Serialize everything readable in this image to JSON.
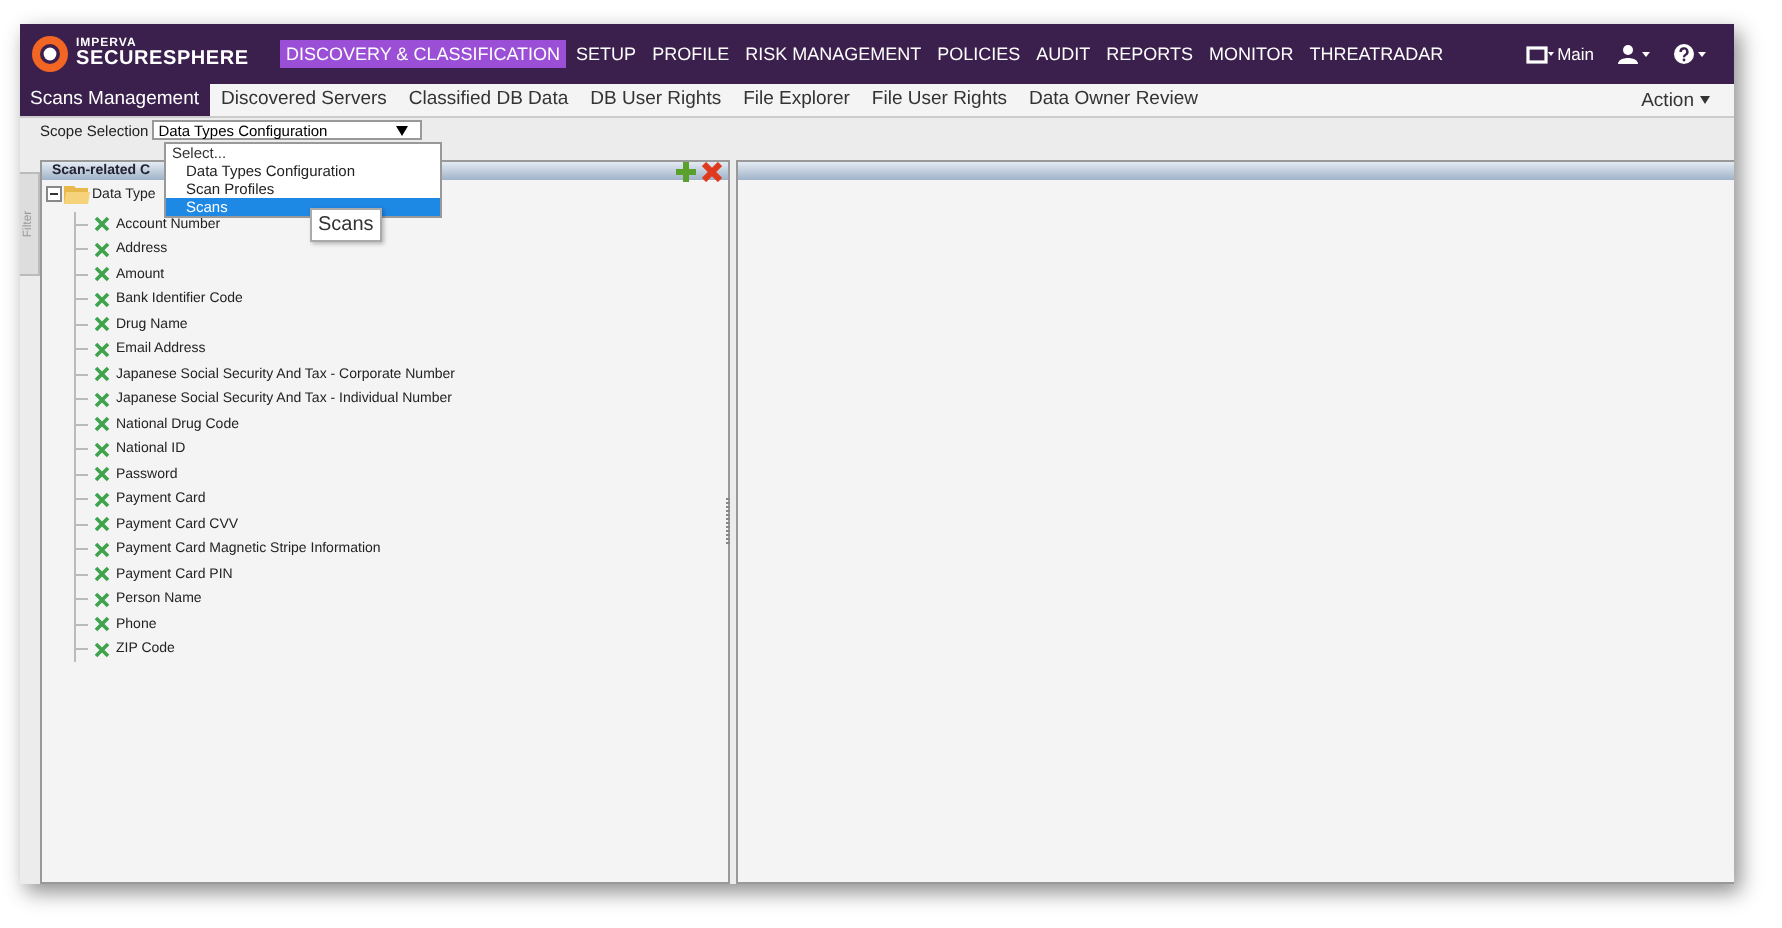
{
  "logo": {
    "brand": "IMPERVA",
    "product": "SECURESPHERE"
  },
  "nav": [
    {
      "label": "DISCOVERY & CLASSIFICATION",
      "selected": true
    },
    {
      "label": "SETUP",
      "selected": false
    },
    {
      "label": "PROFILE",
      "selected": false
    },
    {
      "label": "RISK MANAGEMENT",
      "selected": false
    },
    {
      "label": "POLICIES",
      "selected": false
    },
    {
      "label": "AUDIT",
      "selected": false
    },
    {
      "label": "REPORTS",
      "selected": false
    },
    {
      "label": "MONITOR",
      "selected": false
    },
    {
      "label": "THREATRADAR",
      "selected": false
    }
  ],
  "top_right": {
    "workspace": "Main"
  },
  "subtabs": [
    {
      "label": "Scans Management",
      "selected": true
    },
    {
      "label": "Discovered Servers",
      "selected": false
    },
    {
      "label": "Classified DB Data",
      "selected": false
    },
    {
      "label": "DB User Rights",
      "selected": false
    },
    {
      "label": "File Explorer",
      "selected": false
    },
    {
      "label": "File User Rights",
      "selected": false
    },
    {
      "label": "Data Owner Review",
      "selected": false
    }
  ],
  "action_menu": "Action",
  "scope": {
    "label": "Scope Selection",
    "value": "Data Types Configuration",
    "options": [
      {
        "label": "Select...",
        "kind": "header",
        "highlighted": false
      },
      {
        "label": "Data Types Configuration",
        "kind": "option",
        "highlighted": false
      },
      {
        "label": "Scan Profiles",
        "kind": "option",
        "highlighted": false
      },
      {
        "label": "Scans",
        "kind": "option",
        "highlighted": true
      }
    ]
  },
  "tooltip": "Scans",
  "filter_tab": "Filter",
  "left_panel": {
    "title": "Scan-related C",
    "tree": [
      {
        "label": "Data Type",
        "expanded": true,
        "children": [
          {
            "label": "Account Number"
          },
          {
            "label": "Address"
          },
          {
            "label": "Amount"
          },
          {
            "label": "Bank Identifier Code"
          },
          {
            "label": "Drug Name"
          },
          {
            "label": "Email Address"
          },
          {
            "label": "Japanese Social Security And Tax - Corporate Number"
          },
          {
            "label": "Japanese Social Security And Tax - Individual Number"
          },
          {
            "label": "National Drug Code"
          },
          {
            "label": "National ID"
          },
          {
            "label": "Password"
          },
          {
            "label": "Payment Card"
          },
          {
            "label": "Payment Card CVV"
          },
          {
            "label": "Payment Card Magnetic Stripe Information"
          },
          {
            "label": "Payment Card PIN"
          },
          {
            "label": "Person Name"
          },
          {
            "label": "Phone"
          },
          {
            "label": "ZIP Code"
          }
        ]
      }
    ]
  }
}
